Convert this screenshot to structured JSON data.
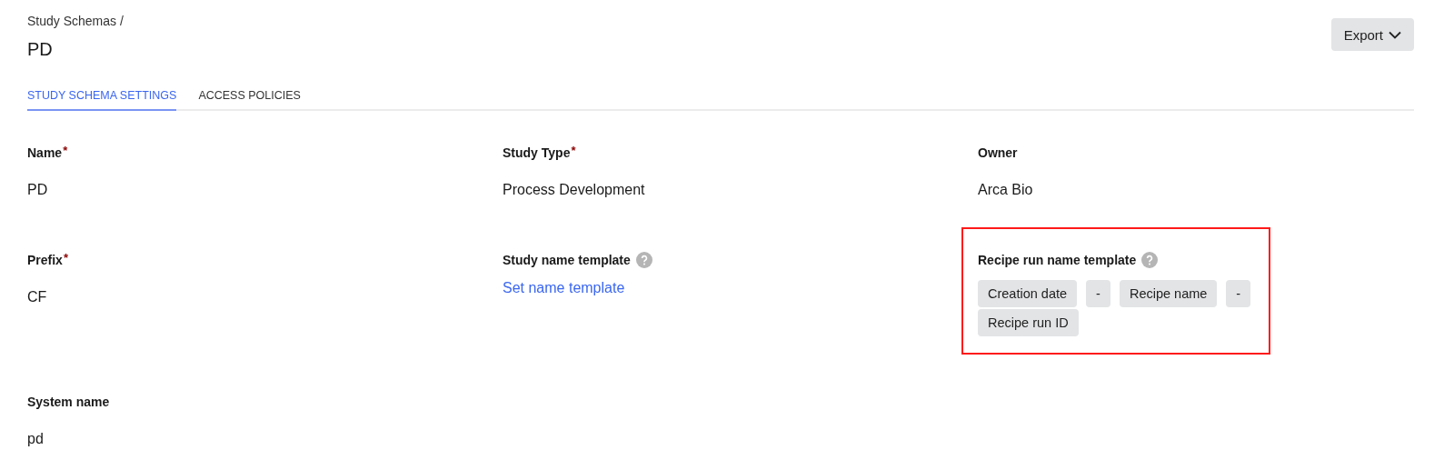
{
  "breadcrumb": "Study Schemas /",
  "title": "PD",
  "export_button": {
    "label": "Export"
  },
  "tabs": [
    {
      "label": "STUDY SCHEMA SETTINGS",
      "selected": true
    },
    {
      "label": "ACCESS POLICIES",
      "selected": false
    }
  ],
  "fields": [
    {
      "label": "Name",
      "required_mark": "*",
      "kind": "text",
      "value": "PD"
    },
    {
      "label": "Study Type",
      "required_mark": "*",
      "kind": "text",
      "value": "Process Development"
    },
    {
      "label": "Owner",
      "kind": "text",
      "value": "Arca Bio"
    },
    {
      "label": "Prefix",
      "required_mark": "*",
      "kind": "text",
      "value": "CF"
    },
    {
      "label": "Study name template",
      "help": true,
      "kind": "link",
      "value": "Set name template"
    },
    {
      "label": "Recipe run name template",
      "help": true,
      "kind": "tokens",
      "tokens": [
        "Creation date",
        "-",
        "Recipe name",
        "-",
        "Recipe run ID"
      ],
      "highlighted": true
    },
    {
      "label": "System name",
      "kind": "text",
      "value": "pd"
    }
  ]
}
